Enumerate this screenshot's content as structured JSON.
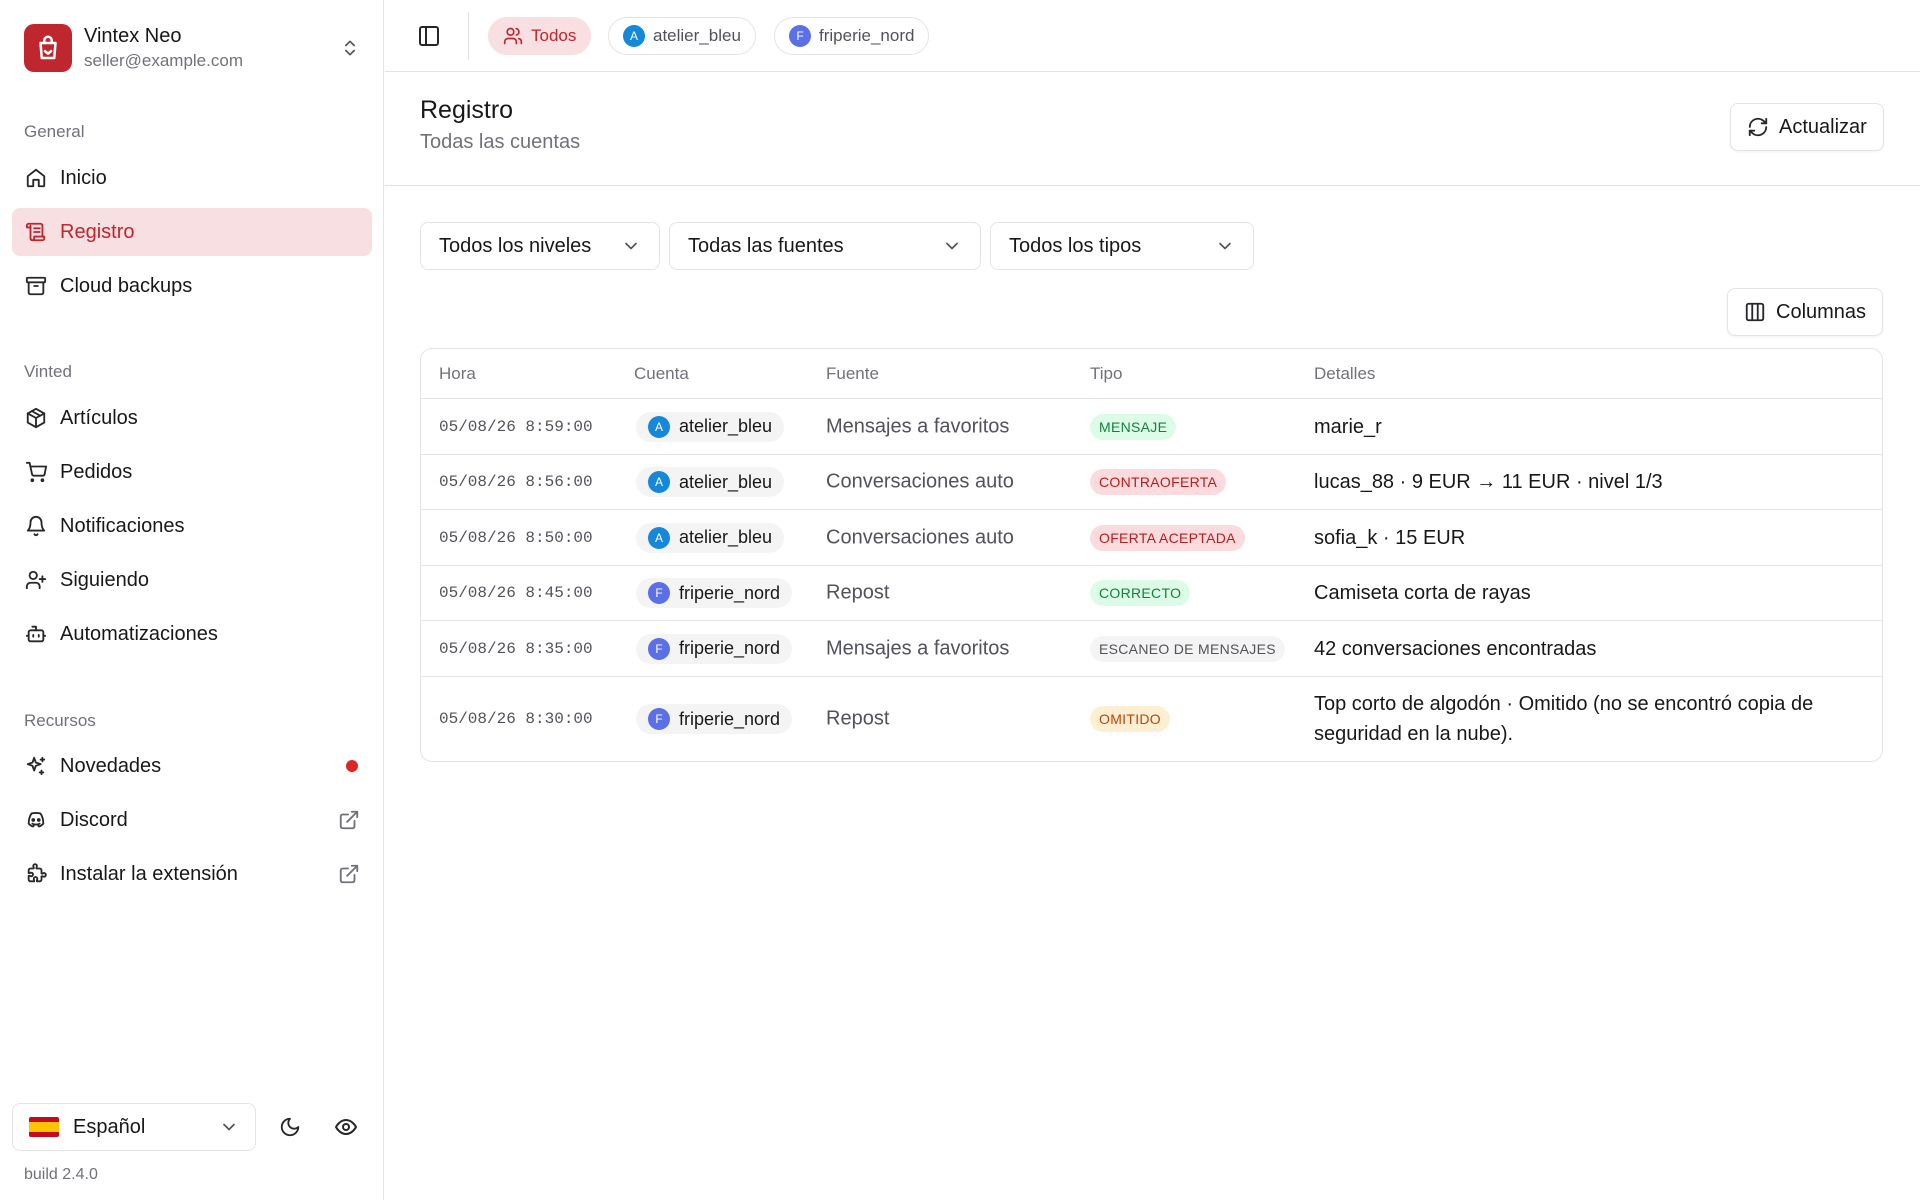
{
  "brand": {
    "name": "Vintex Neo",
    "email": "seller@example.com"
  },
  "sidebar": {
    "groups": [
      {
        "label": "General"
      },
      {
        "label": "Vinted"
      },
      {
        "label": "Recursos"
      }
    ],
    "items": {
      "inicio": "Inicio",
      "registro": "Registro",
      "cloud": "Cloud backups",
      "articulos": "Artículos",
      "pedidos": "Pedidos",
      "notificaciones": "Notificaciones",
      "siguiendo": "Siguiendo",
      "automatizaciones": "Automatizaciones",
      "novedades": "Novedades",
      "discord": "Discord",
      "extension": "Instalar la extensión"
    },
    "active": "registro",
    "language": "Español",
    "build": "build 2.4.0"
  },
  "topbar": {
    "chips": [
      {
        "label": "Todos",
        "active": true
      },
      {
        "label": "atelier_bleu",
        "initial": "A"
      },
      {
        "label": "friperie_nord",
        "initial": "F"
      }
    ]
  },
  "header": {
    "title": "Registro",
    "subtitle": "Todas las cuentas",
    "refresh_label": "Actualizar"
  },
  "filters": {
    "level": "Todos los niveles",
    "source": "Todas las fuentes",
    "type": "Todos los tipos"
  },
  "columns_label": "Columnas",
  "table": {
    "headers": {
      "time": "Hora",
      "account": "Cuenta",
      "source": "Fuente",
      "type": "Tipo",
      "details": "Detalles"
    },
    "rows": [
      {
        "time": "05/08/26 8:59:00",
        "account": "atelier_bleu",
        "initial": "A",
        "source": "Mensajes a favoritos",
        "type": "MENSAJE",
        "type_color": "green",
        "details": "marie_r"
      },
      {
        "time": "05/08/26 8:56:00",
        "account": "atelier_bleu",
        "initial": "A",
        "source": "Conversaciones auto",
        "type": "CONTRAOFERTA",
        "type_color": "red",
        "details": "lucas_88 · 9 EUR → 11 EUR · nivel 1/3"
      },
      {
        "time": "05/08/26 8:50:00",
        "account": "atelier_bleu",
        "initial": "A",
        "source": "Conversaciones auto",
        "type": "OFERTA ACEPTADA",
        "type_color": "red",
        "details": "sofia_k · 15 EUR"
      },
      {
        "time": "05/08/26 8:45:00",
        "account": "friperie_nord",
        "initial": "F",
        "source": "Repost",
        "type": "CORRECTO",
        "type_color": "green",
        "details": "Camiseta corta de rayas"
      },
      {
        "time": "05/08/26 8:35:00",
        "account": "friperie_nord",
        "initial": "F",
        "source": "Mensajes a favoritos",
        "type": "ESCANEO DE MENSAJES",
        "type_color": "gray",
        "details": "42 conversaciones encontradas"
      },
      {
        "time": "05/08/26 8:30:00",
        "account": "friperie_nord",
        "initial": "F",
        "source": "Repost",
        "type": "OMITIDO",
        "type_color": "amber",
        "details": "Top corto de algodón · Omitido (no se encontró copia de seguridad en la nube)."
      }
    ]
  }
}
